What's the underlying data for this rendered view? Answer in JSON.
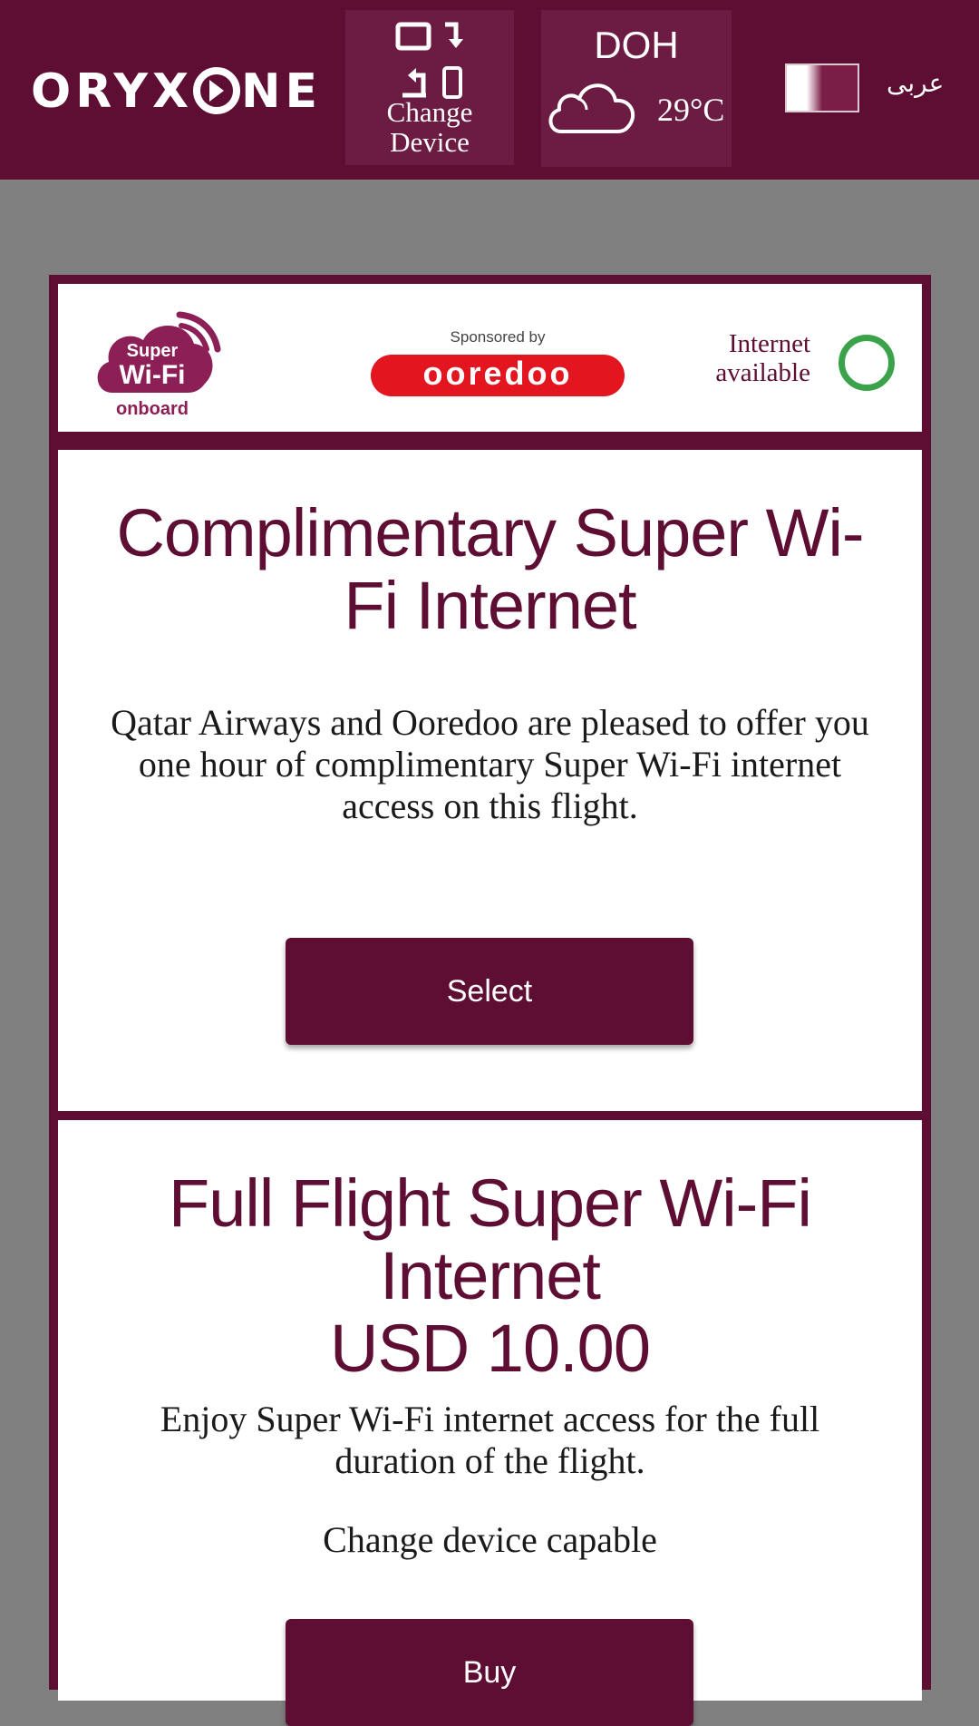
{
  "header": {
    "logo_text": "ORYX ONE",
    "change_device_label": "Change Device",
    "weather": {
      "city": "DOH",
      "temperature": "29°C",
      "condition_icon": "cloud-icon"
    },
    "language_label": "عربى",
    "flag_icon": "qatar-flag-icon"
  },
  "status": {
    "wifi_logo": {
      "line1": "Super",
      "line2": "Wi-Fi",
      "line3": "onboard"
    },
    "sponsored_by": "Sponsored by",
    "sponsor_logo_text": "ooredoo",
    "internet_status": "Internet available",
    "status_color": "#3aa34a"
  },
  "offers": [
    {
      "title": "Complimentary Super Wi-Fi Internet",
      "description": "Qatar Airways and Ooredoo are pleased to offer you one hour of complimentary Super Wi-Fi internet access on this flight.",
      "button_label": "Select"
    },
    {
      "title": "Full Flight Super Wi-Fi Internet",
      "price": "USD 10.00",
      "description": "Enjoy Super Wi-Fi internet access for the full duration of the flight.",
      "note": "Change device capable",
      "button_label": "Buy"
    }
  ],
  "colors": {
    "brand": "#5e0d33",
    "background": "#808080",
    "panel": "#ffffff"
  }
}
